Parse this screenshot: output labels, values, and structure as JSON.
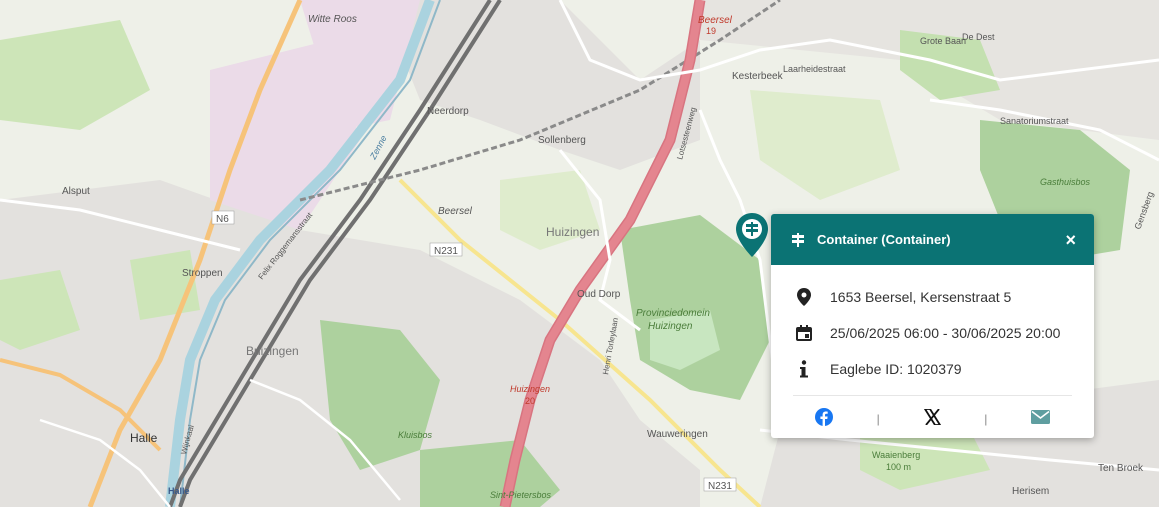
{
  "map": {
    "place_labels": {
      "witte_roos": "Witte Roos",
      "beersel_top": "Beersel",
      "beersel_road_no": "19",
      "kesterbeek": "Kesterbeek",
      "grote_baan": "Grote Baan",
      "de_dest": "De Dest",
      "laarheidestraat": "Laarheidestraat",
      "neerdorp": "Neerdorp",
      "sollenberg": "Sollenberg",
      "sanatoriumstraat": "Sanatoriumstraat",
      "gasthuisbos": "Gasthuisbos",
      "alsput": "Alsput",
      "n6": "N6",
      "beersel_mid": "Beersel",
      "n231_a": "N231",
      "huizingen": "Huizingen",
      "stroppen": "Stroppen",
      "oud_dorp": "Oud Dorp",
      "provinciedomein": "Provinciedomein",
      "huizingen_park": "Huizingen",
      "buizingen": "Buizingen",
      "henri_torleylaan": "Henri Torleylaan",
      "huizingen_exit": "Huizingen",
      "exit_no": "20",
      "halle": "Halle",
      "halle_station": "Halle",
      "wauweringen": "Wauweringen",
      "kluisbos": "Kluisbos",
      "waaienberg": "Waaienberg",
      "waaienberg_alt": "100 m",
      "ten_broek": "Ten Broek",
      "herisem": "Herisem",
      "n231_b": "N231",
      "sint_pietersbos": "Sint-Pietersbos",
      "lotsestraat": "Lotsesteenweg",
      "feliz": "Felix Roggemansstraat",
      "gensberg": "Gensberg",
      "zenne": "Zenne",
      "wijnkaai": "Wijnkaai"
    },
    "colors": {
      "motorway": "#e4858f",
      "primary": "#f6c37a",
      "forest": "#add19e",
      "water": "#aad3df",
      "urban": "#e0dfdf",
      "industrial": "#ebdbe8",
      "accent": "#0b7374"
    }
  },
  "popup": {
    "title": "Container (Container)",
    "address": "1653 Beersel, Kersenstraat 5",
    "period": "25/06/2025 06:00 - 30/06/2025 20:00",
    "eaglebe_id": "Eaglebe ID: 1020379",
    "close_label": "×",
    "separator": "|",
    "icons": {
      "header": "road-sign-icon",
      "address": "location-pin-icon",
      "period": "calendar-icon",
      "id": "info-icon",
      "facebook": "facebook-icon",
      "x": "x-icon",
      "email": "email-icon"
    }
  }
}
